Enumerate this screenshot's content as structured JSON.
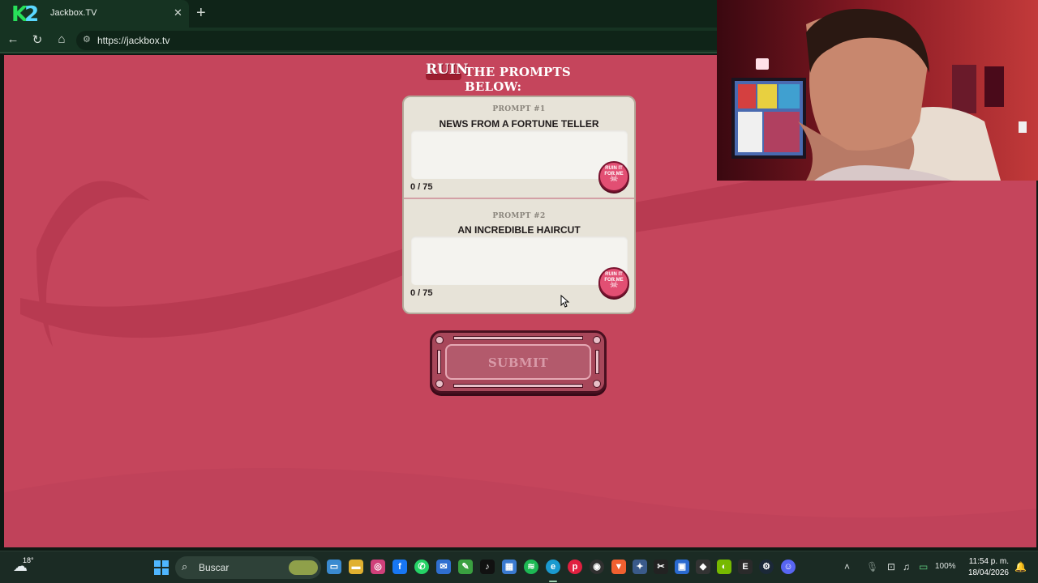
{
  "browser": {
    "tab_title": "Jackbox.TV",
    "url": "https://jackbox.tv",
    "tab_close": "✕",
    "new_tab": "+",
    "logo_letters": [
      "K",
      "2"
    ]
  },
  "game": {
    "heading_highlight": "RUIN",
    "heading_rest": "THE PROMPTS BELOW:",
    "prompts": [
      {
        "label": "PROMPT #1",
        "text": "NEWS FROM A FORTUNE TELLER",
        "value": "",
        "counter": "0 / 75"
      },
      {
        "label": "PROMPT #2",
        "text": "AN INCREDIBLE HAIRCUT",
        "value": "",
        "counter": "0 / 75"
      }
    ],
    "ruin_button_text": "RUIN IT FOR ME",
    "submit_label": "SUBMIT",
    "colors": {
      "page_bg": "#c5455c",
      "card_bg": "#e7e3d8",
      "ruin_btn": "#e24f73"
    }
  },
  "taskbar": {
    "temperature": "18°",
    "search_placeholder": "Buscar",
    "battery": "100%",
    "time": "11:54 p. m.",
    "date": "18/04/2026",
    "apps": [
      "task-view",
      "file-explorer",
      "instagram",
      "facebook",
      "whatsapp",
      "mail",
      "notepad",
      "tiktok",
      "store",
      "spotify",
      "edge",
      "pinterest",
      "obs",
      "brave",
      "app-a",
      "capcut",
      "app-b",
      "app-c",
      "steam",
      "nvidia",
      "epic-games",
      "steam-b",
      "discord"
    ]
  }
}
